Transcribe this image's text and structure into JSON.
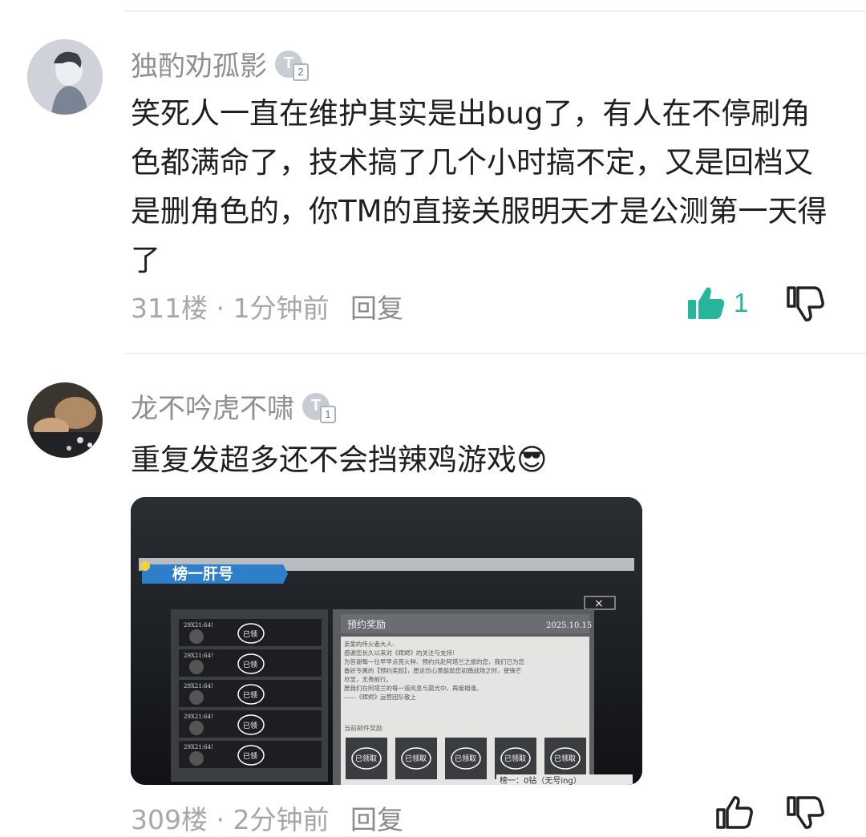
{
  "comments": [
    {
      "username": "独酌劝孤影",
      "level": "2",
      "text": "笑死人一直在维护其实是出bug了，有人在不停刷角色都满命了，技术搞了几个小时搞不定，又是回档又是删角色的，你TM的直接关服明天才是公测第一天得了",
      "floor": "311楼",
      "time": "1分钟前",
      "reply_label": "回复",
      "likes": "1",
      "liked": true
    },
    {
      "username": "龙不吟虎不啸",
      "level": "1",
      "text": "重复发超多还不会挡辣鸡游戏😎",
      "floor": "309楼",
      "time": "2分钟前",
      "reply_label": "回复",
      "likes": "",
      "liked": false,
      "attachment": {
        "banner": "榜一肝号",
        "popup_title": "预约奖励",
        "popup_date": "2025.10.15",
        "popup_lines": [
          "亲爱的传火者大人:",
          "感谢您长久以来对《辉烬》的关注与支持!",
          "为答谢每一位早早点亮火种、预约共赴阿塔兰之旅的您，我们已为您",
          "备好专属的【预约奖励】，愿这份心意能助您初踏战场之时，使锋芒",
          "尽显，无畏前行。",
          "愿我们在阿塔兰的每一道风息与晨光中，再度相逢。",
          "——《辉烬》运营团队敬上"
        ],
        "attachments_label": "当前邮件奖励",
        "claimed_label": "已领取",
        "row_tag": "29X21:64!",
        "row_claimed": "已领",
        "footer_text": "榜一：0钻（无号ing）"
      }
    }
  ],
  "colors": {
    "like_active": "#27b59e",
    "meta_gray": "#a7a7a7",
    "name_gray": "#8f8f8f"
  }
}
